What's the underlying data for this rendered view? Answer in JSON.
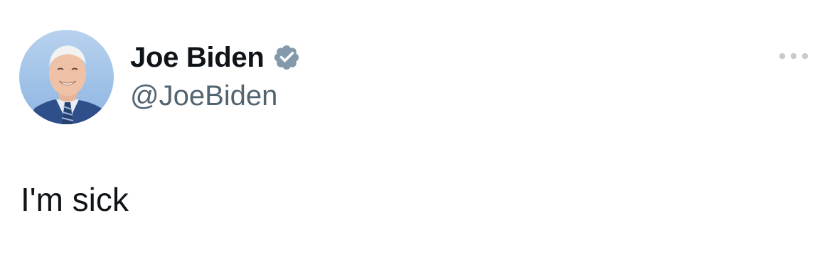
{
  "tweet": {
    "author": {
      "display_name": "Joe Biden",
      "handle": "@JoeBiden",
      "verified": true,
      "verified_badge_color": "#829aab"
    },
    "text": "I'm sick",
    "more_icon": "more-horizontal-icon"
  },
  "colors": {
    "text_primary": "#0f1419",
    "text_secondary": "#536471",
    "background": "#ffffff"
  }
}
